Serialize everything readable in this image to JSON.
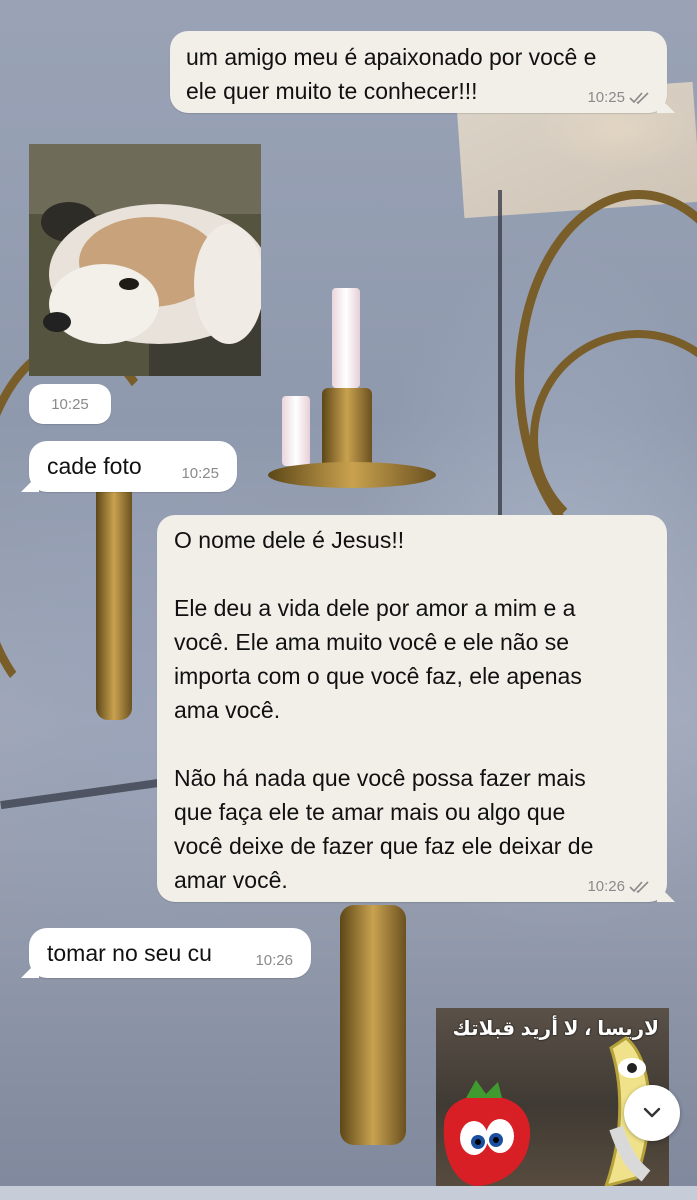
{
  "messages": [
    {
      "id": "m1",
      "direction": "outgoing",
      "text": "um amigo meu é apaixonado por você e\nele quer muito te conhecer!!!",
      "time": "10:25",
      "status": "read"
    },
    {
      "id": "m2",
      "direction": "incoming",
      "type": "photo",
      "time": "10:25"
    },
    {
      "id": "m3",
      "direction": "incoming",
      "text": "cade foto",
      "time": "10:25"
    },
    {
      "id": "m4",
      "direction": "outgoing",
      "text": "O nome dele é Jesus!!\n\nEle deu a vida dele por amor a mim e a\nvocê. Ele ama muito você e ele não se\nimporta com o que você faz, ele apenas\nama você.\n\nNão há nada que você possa fazer mais\nque faça ele te amar mais ou algo que\nvocê deixe de fazer que faz ele deixar de\namar você.",
      "time": "10:26",
      "status": "read"
    },
    {
      "id": "m5",
      "direction": "incoming",
      "text": "tomar no seu cu",
      "time": "10:26"
    },
    {
      "id": "m6",
      "direction": "outgoing",
      "type": "sticker",
      "caption": "لاريسا ، لا أريد قبلاتك"
    }
  ],
  "icons": {
    "read_receipt": "double-check-icon",
    "scroll_down": "chevron-down-icon"
  },
  "colors": {
    "bubble_incoming": "#ffffff",
    "bubble_outgoing": "#f2efe9",
    "time_text": "#8a8a8a",
    "read_ticks": "#8a8a8a"
  }
}
